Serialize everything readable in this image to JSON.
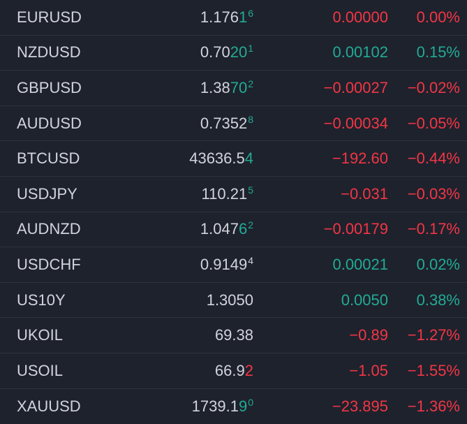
{
  "colors": {
    "background": "#1e222d",
    "text": "#d1d4dc",
    "positive": "#22ab94",
    "negative": "#f23645",
    "divider": "#2e323d"
  },
  "rows": [
    {
      "symbol": "EURUSD",
      "price_base": "1.176",
      "price_digits": "1",
      "price_pip": "6",
      "price_dir": "up",
      "change": "0.00000",
      "pct": "0.00%",
      "sign": "neg"
    },
    {
      "symbol": "NZDUSD",
      "price_base": "0.70",
      "price_digits": "20",
      "price_pip": "1",
      "price_dir": "up",
      "change": "0.00102",
      "pct": "0.15%",
      "sign": "pos"
    },
    {
      "symbol": "GBPUSD",
      "price_base": "1.38",
      "price_digits": "70",
      "price_pip": "2",
      "price_dir": "up",
      "change": "−0.00027",
      "pct": "−0.02%",
      "sign": "neg"
    },
    {
      "symbol": "AUDUSD",
      "price_base": "0.7352",
      "price_digits": "",
      "price_pip": "8",
      "price_dir": "up",
      "change": "−0.00034",
      "pct": "−0.05%",
      "sign": "neg"
    },
    {
      "symbol": "BTCUSD",
      "price_base": "43636.5",
      "price_digits": "4",
      "price_pip": "",
      "price_dir": "up",
      "change": "−192.60",
      "pct": "−0.44%",
      "sign": "neg"
    },
    {
      "symbol": "USDJPY",
      "price_base": "110.21",
      "price_digits": "",
      "price_pip": "5",
      "price_dir": "up",
      "change": "−0.031",
      "pct": "−0.03%",
      "sign": "neg"
    },
    {
      "symbol": "AUDNZD",
      "price_base": "1.047",
      "price_digits": "6",
      "price_pip": "2",
      "price_dir": "up",
      "change": "−0.00179",
      "pct": "−0.17%",
      "sign": "neg"
    },
    {
      "symbol": "USDCHF",
      "price_base": "0.9149",
      "price_digits": "",
      "price_pip": "4",
      "price_dir": "flat",
      "change": "0.00021",
      "pct": "0.02%",
      "sign": "pos"
    },
    {
      "symbol": "US10Y",
      "price_base": "1.3050",
      "price_digits": "",
      "price_pip": "",
      "price_dir": "flat",
      "change": "0.0050",
      "pct": "0.38%",
      "sign": "pos"
    },
    {
      "symbol": "UKOIL",
      "price_base": "69.38",
      "price_digits": "",
      "price_pip": "",
      "price_dir": "flat",
      "change": "−0.89",
      "pct": "−1.27%",
      "sign": "neg"
    },
    {
      "symbol": "USOIL",
      "price_base": "66.9",
      "price_digits": "2",
      "price_pip": "",
      "price_dir": "down",
      "change": "−1.05",
      "pct": "−1.55%",
      "sign": "neg"
    },
    {
      "symbol": "XAUUSD",
      "price_base": "1739.1",
      "price_digits": "9",
      "price_pip": "0",
      "price_dir": "up",
      "change": "−23.895",
      "pct": "−1.36%",
      "sign": "neg"
    }
  ]
}
